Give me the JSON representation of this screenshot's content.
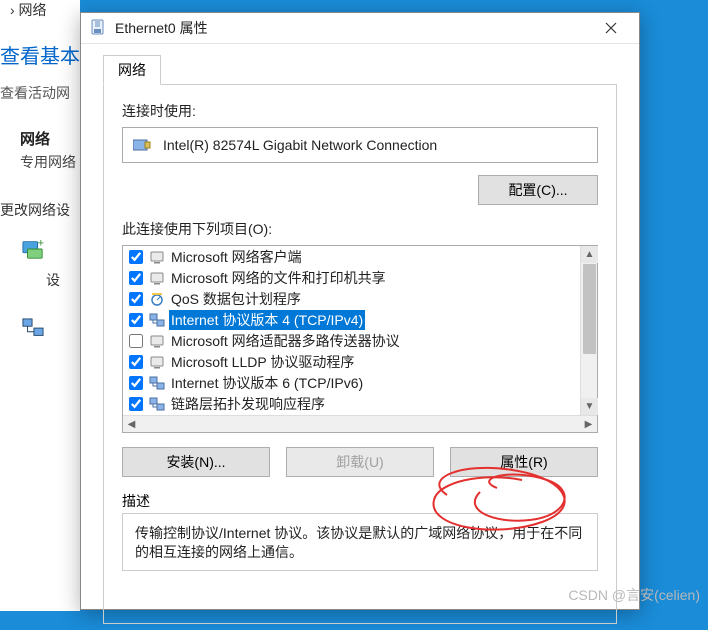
{
  "background": {
    "breadcrumb": "› 网络",
    "link1": "查看基本",
    "link2": "查看活动网",
    "heading": "网络",
    "sub": "专用网络",
    "link3": "更改网络设"
  },
  "dialog": {
    "title": "Ethernet0 属性",
    "tab": "网络",
    "connect_label": "连接时使用:",
    "adapter": "Intel(R) 82574L Gigabit Network Connection",
    "config_btn": "配置(C)...",
    "items_label": "此连接使用下列项目(O):",
    "items": [
      {
        "checked": true,
        "icon": "client",
        "label": "Microsoft 网络客户端"
      },
      {
        "checked": true,
        "icon": "client",
        "label": "Microsoft 网络的文件和打印机共享"
      },
      {
        "checked": true,
        "icon": "qos",
        "label": "QoS 数据包计划程序"
      },
      {
        "checked": true,
        "icon": "proto",
        "label": "Internet 协议版本 4 (TCP/IPv4)",
        "selected": true
      },
      {
        "checked": false,
        "icon": "client",
        "label": "Microsoft 网络适配器多路传送器协议"
      },
      {
        "checked": true,
        "icon": "client",
        "label": "Microsoft LLDP 协议驱动程序"
      },
      {
        "checked": true,
        "icon": "proto",
        "label": "Internet 协议版本 6 (TCP/IPv6)"
      },
      {
        "checked": true,
        "icon": "proto",
        "label": "链路层拓扑发现响应程序"
      }
    ],
    "install_btn": "安装(N)...",
    "uninstall_btn": "卸载(U)",
    "props_btn": "属性(R)",
    "desc_label": "描述",
    "desc_text": "传输控制协议/Internet 协议。该协议是默认的广域网络协议，用于在不同的相互连接的网络上通信。"
  },
  "watermark": "CSDN @言安(celien)"
}
